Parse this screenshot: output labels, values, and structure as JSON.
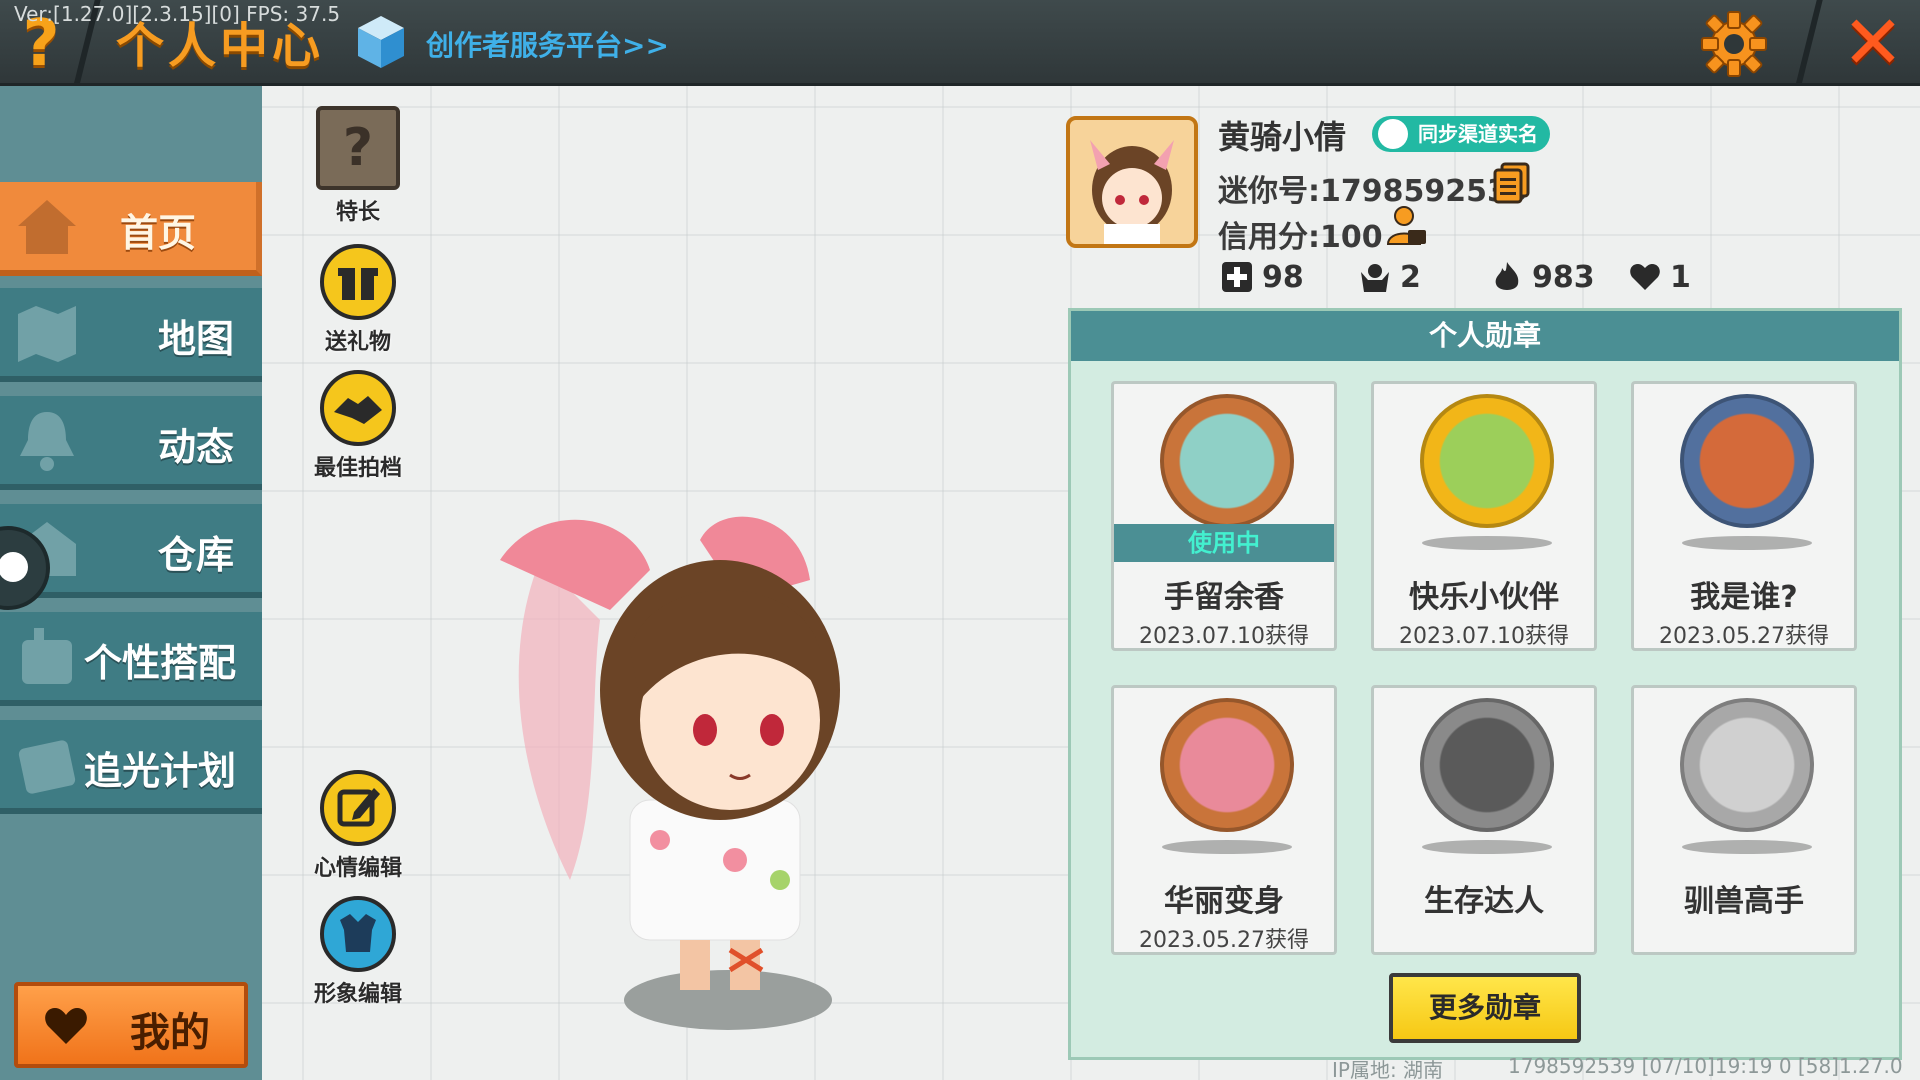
{
  "debug": "Ver:[1.27.0][2.3.15][0] FPS: 37.5",
  "header": {
    "help_icon": "?",
    "title": "个人中心",
    "creator_link": "创作者服务平台>>",
    "close_icon": "✕",
    "accent_color": "#f79c21"
  },
  "sidebar": {
    "items": [
      {
        "label": "首页",
        "icon": "house-icon",
        "active": true
      },
      {
        "label": "地图",
        "icon": "map-icon",
        "active": false
      },
      {
        "label": "动态",
        "icon": "bell-icon",
        "active": false
      },
      {
        "label": "仓库",
        "icon": "warehouse-icon",
        "active": false
      },
      {
        "label": "个性搭配",
        "icon": "outfit-icon",
        "active": false
      },
      {
        "label": "追光计划",
        "icon": "light-plan-icon",
        "active": false
      }
    ],
    "my_button": "我的"
  },
  "actions": {
    "talent": {
      "label": "特长",
      "icon_text": "?"
    },
    "gift": {
      "label": "送礼物"
    },
    "partner": {
      "label": "最佳拍档"
    },
    "mood_edit": {
      "label": "心情编辑"
    },
    "image_edit": {
      "label": "形象编辑"
    }
  },
  "profile": {
    "nickname": "黄骑小倩",
    "realname_badge": "同步渠道实名",
    "mini_id": "迷你号:1798592539",
    "credit": "信用分:100",
    "stats": [
      {
        "icon": "plus-square-icon",
        "value": "98"
      },
      {
        "icon": "fan-icon",
        "value": "2"
      },
      {
        "icon": "flame-icon",
        "value": "983"
      },
      {
        "icon": "heart-icon",
        "value": "1"
      }
    ]
  },
  "medals": {
    "title": "个人勋章",
    "in_use_label": "使用中",
    "items": [
      {
        "name": "手留余香",
        "date": "2023.07.10获得",
        "in_use": true,
        "ring": "#c9743a",
        "inner": "#8fd0c6"
      },
      {
        "name": "快乐小伙伴",
        "date": "2023.07.10获得",
        "in_use": false,
        "ring": "#f2b618",
        "inner": "#9ccf5a"
      },
      {
        "name": "我是谁?",
        "date": "2023.05.27获得",
        "in_use": false,
        "ring": "#52709e",
        "inner": "#d46a3a"
      },
      {
        "name": "华丽变身",
        "date": "2023.05.27获得",
        "in_use": false,
        "ring": "#c9743a",
        "inner": "#e98a9a"
      },
      {
        "name": "生存达人",
        "date": "",
        "in_use": false,
        "ring": "#8a8a8a",
        "inner": "#5a5a5a"
      },
      {
        "name": "驯兽高手",
        "date": "",
        "in_use": false,
        "ring": "#a8a8a8",
        "inner": "#d0d0d0"
      }
    ],
    "more_button": "更多勋章"
  },
  "footer": {
    "ip_location": "IP属地: 湖南",
    "info": "1798592539   [07/10]19:19 0   [58]1.27.0"
  }
}
